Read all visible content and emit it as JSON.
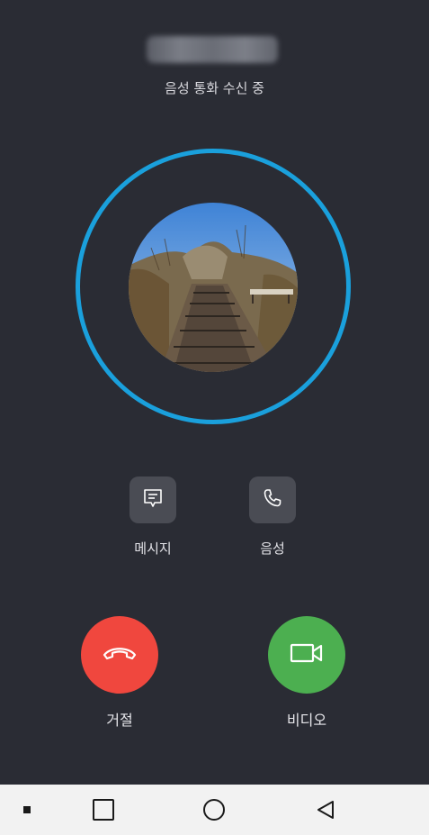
{
  "call": {
    "status": "음성 통화 수신 중"
  },
  "actions": {
    "message_label": "메시지",
    "voice_label": "음성"
  },
  "buttons": {
    "decline_label": "거절",
    "video_label": "비디오"
  },
  "colors": {
    "background": "#2a2c34",
    "ring": "#1aa0dc",
    "decline": "#f0473e",
    "video": "#4caf50",
    "navbar": "#f2f2f2"
  },
  "icons": {
    "message": "message-icon",
    "voice": "phone-icon",
    "decline": "hang-up-icon",
    "video": "video-camera-icon"
  }
}
